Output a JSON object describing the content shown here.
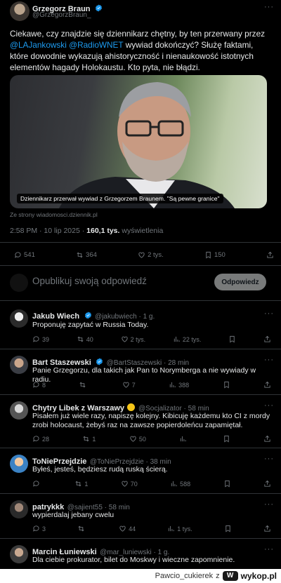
{
  "main_tweet": {
    "author_name": "Grzegorz Braun",
    "author_handle": "@GrzegorzBraun_",
    "text_before": "Ciekawe, czy znajdzie się dziennikarz chętny, by ten przerwany przez",
    "mention1": "@LAJankowski",
    "mention2": "@RadioWNET",
    "text_after": "wywiad dokończyć? Służę faktami, które dowodnie wykazują ahistoryczność i nienaukowość istotnych elementów hagady Holokaustu. Kto pyta, nie błądzi.",
    "media_caption": "Dziennikarz przerwał wywiad z Grzegorzem Braunem. \"Są pewne granice\"",
    "media_source": "Ze strony wiadomosci.dziennik.pl",
    "time": "2:58 PM · 10 lip 2025 ·",
    "views_count": "160,1 tys.",
    "views_label": "wyświetlenia",
    "stats": {
      "replies": "541",
      "reposts": "364",
      "likes": "2 tys.",
      "bookmarks": "150"
    }
  },
  "compose": {
    "placeholder": "Opublikuj swoją odpowiedź",
    "button_label": "Odpowiedz"
  },
  "replies": [
    {
      "name": "Jakub Wiech",
      "handle": "@jakubwiech · 1 g.",
      "text": "Proponuję zapytać w Russia Today.",
      "replies": "39",
      "reposts": "40",
      "likes": "2 tys.",
      "views": "22 tys."
    },
    {
      "name": "Bart Staszewski",
      "handle": "@BartStaszewski · 28 min",
      "text": "Panie Grzegorzu, dla takich jak Pan to Norymberga a nie wywiady w radiu.",
      "replies": "8",
      "reposts": "",
      "likes": "7",
      "views": "388"
    },
    {
      "name": "Chytry Libek z Warszawy",
      "handle": "@Socjalizator · 58 min",
      "text": "Pisałem już wiele razy, napiszę kolejny. Kibicuję każdemu kto CI z mordy zrobi holocaust, żebyś raz na zawsze popierdoleńcu zapamiętał.",
      "replies": "28",
      "reposts": "1",
      "likes": "50",
      "views": ""
    },
    {
      "name": "ToNiePrzejdzie",
      "handle": "@ToNiePrzejdzie · 38 min",
      "text": "Byłeś, jesteś, będziesz rudą ruską ścierą.",
      "replies": "",
      "reposts": "1",
      "likes": "70",
      "views": "588"
    },
    {
      "name": "patrykkk",
      "handle": "@sajient55 · 58 min",
      "text": "wypierdalaj jebany cwelu",
      "replies": "3",
      "reposts": "",
      "likes": "44",
      "views": "1 tys."
    },
    {
      "name": "Marcin Łuniewski",
      "handle": "@mar_luniewski · 1 g.",
      "text": "Dla ciebie prokurator, bilet do Moskwy i wieczne zapomnienie.",
      "replies": "",
      "reposts": "",
      "likes": "",
      "views": ""
    }
  ],
  "footer": {
    "user": "Pawcio_cukierek",
    "separator": "z",
    "brand": "wykop.pl"
  }
}
